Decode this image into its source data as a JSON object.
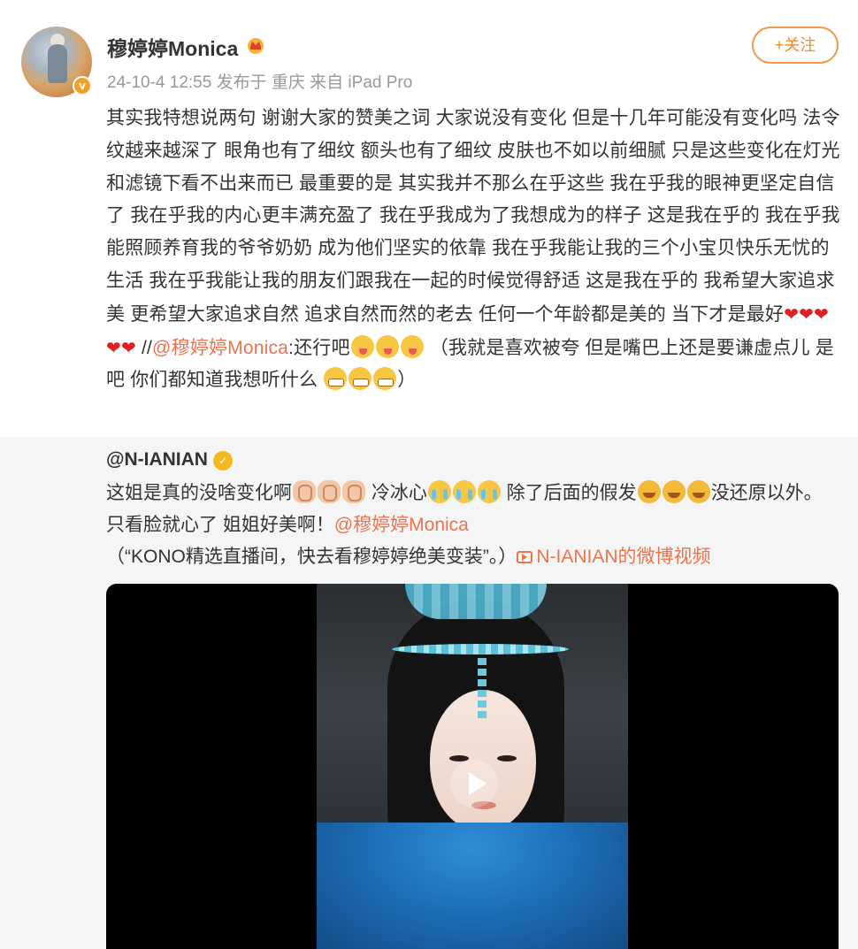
{
  "post": {
    "username": "穆婷婷Monica",
    "meta": "24-10-4 12:55 发布于 重庆 来自 iPad Pro",
    "follow_label": "+关注",
    "verified_badge": "v",
    "text_part1": "其实我特想说两句 谢谢大家的赞美之词 大家说没有变化 但是十几年可能没有变化吗 法令纹越来越深了 眼角也有了细纹 额头也有了细纹 皮肤也不如以前细腻 只是这些变化在灯光和滤镜下看不出来而已 最重要的是 其实我并不那么在乎这些 我在乎我的眼神更坚定自信了 我在乎我的内心更丰满充盈了 我在乎我成为了我想成为的样子 这是我在乎的 我在乎我能照顾养育我的爷爷奶奶 成为他们坚实的依靠 我在乎我能让我的三个小宝贝快乐无忧的生活 我在乎我能让我的朋友们跟我在一起的时候觉得舒适 这是我在乎的 我希望大家追求美 更希望大家追求自然 追求自然而然的老去 任何一个年龄都是美的 当下才是最好",
    "hearts": "❤❤❤❤❤",
    "repost_sep": " //",
    "mention": "@穆婷婷Monica",
    "text_part2": ":还行吧",
    "text_part3": " （我就是喜欢被夸 但是嘴巴上还是要谦虚点儿 是吧 你们都知道我想听什么 ",
    "text_part4": "）"
  },
  "repost": {
    "username": "@N-IANIAN",
    "verified_badge": "✓",
    "text_a": "这姐是真的没啥变化啊",
    "text_b": " 冷冰心",
    "text_c": " 除了后面的假发",
    "text_d": "没还原以外。只看脸就心了  姐姐好美啊！",
    "mention": "@穆婷婷Monica",
    "quote": "（“KONO精选直播间，快去看穆婷婷绝美变装”。）",
    "video_link": "N-IANIAN的微博视频"
  },
  "colors": {
    "accent": "#eb7350",
    "follow": "#f08a2a",
    "repost_bg": "#f5f5f5",
    "meta": "#999999"
  },
  "icons": [
    "crown-icon",
    "verified-icon",
    "heart-icon",
    "tongue-emoji-icon",
    "grin-emoji-icon",
    "clap-emoji-icon",
    "cry-emoji-icon",
    "lol-emoji-icon",
    "video-icon",
    "play-icon"
  ]
}
